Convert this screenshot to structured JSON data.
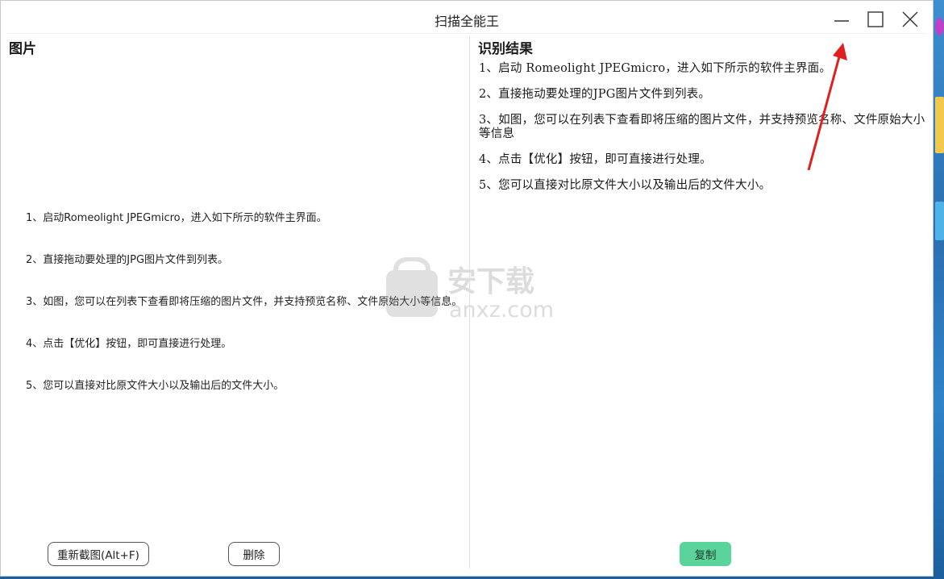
{
  "window": {
    "title": "扫描全能王",
    "controls": {
      "minimize": "minimize-icon",
      "maximize": "maximize-icon",
      "close": "close-icon"
    }
  },
  "left_panel": {
    "heading": "图片",
    "image_lines": [
      "1、启动Romeolight JPEGmicro，进入如下所示的软件主界面。",
      "2、直接拖动要处理的JPG图片文件到列表。",
      "3、如图，您可以在列表下查看即将压缩的图片文件，并支持预览名称、文件原始大小等信息。",
      "4、点击【优化】按钮，即可直接进行处理。",
      "5、您可以直接对比原文件大小以及输出后的文件大小。"
    ],
    "rescreenshot_button": "重新截图(Alt+F)",
    "delete_button": "删除"
  },
  "right_panel": {
    "heading": "识别结果",
    "result_lines": [
      "1、启动 Romeolight JPEGmicro，进入如下所示的软件主界面。",
      "2、直接拖动要处理的JPG图片文件到列表。",
      "3、如图，您可以在列表下查看即将压缩的图片文件，并支持预览名称、文件原始大小等信息",
      "4、点击【优化】按钮，即可直接进行处理。",
      "5、您可以直接对比原文件大小以及输出后的文件大小。"
    ],
    "copy_button": "复制"
  },
  "watermark": {
    "text_cn": "安下载",
    "text_en": "anxz.com"
  },
  "colors": {
    "copy_button": "#5ad49a",
    "annotation_arrow": "#e02020"
  }
}
